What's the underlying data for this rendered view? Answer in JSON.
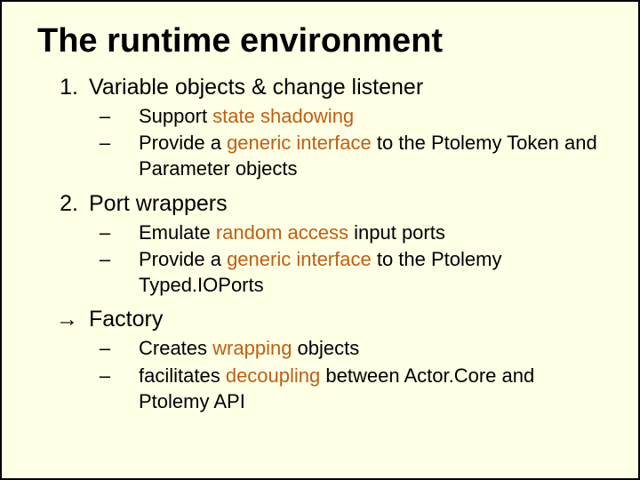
{
  "title": "The runtime environment",
  "items": [
    {
      "num": "1.",
      "head": "Variable objects & change listener",
      "subs": [
        {
          "pre": "Support ",
          "accent": "state shadowing",
          "post": ""
        },
        {
          "pre": "Provide a ",
          "accent": "generic interface",
          "post": " to the Ptolemy Token and Parameter objects"
        }
      ]
    },
    {
      "num": "2.",
      "head": "Port wrappers",
      "subs": [
        {
          "pre": "Emulate ",
          "accent": "random access",
          "post": " input ports"
        },
        {
          "pre": "Provide a ",
          "accent": "generic interface",
          "post": " to the Ptolemy Typed.IOPorts"
        }
      ]
    },
    {
      "num": "→",
      "head": "Factory",
      "subs": [
        {
          "pre": "Creates ",
          "accent": "wrapping",
          "post": " objects"
        },
        {
          "pre": "facilitates ",
          "accent": "decoupling",
          "post": " between Actor.Core and Ptolemy API"
        }
      ]
    }
  ],
  "bullet": "–"
}
